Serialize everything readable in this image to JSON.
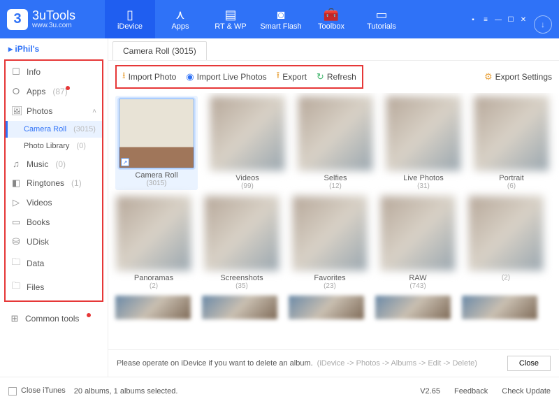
{
  "brand": {
    "name": "3uTools",
    "site": "www.3u.com",
    "logo_char": "3"
  },
  "topnav": [
    {
      "label": "iDevice"
    },
    {
      "label": "Apps"
    },
    {
      "label": "RT & WP"
    },
    {
      "label": "Smart Flash"
    },
    {
      "label": "Toolbox"
    },
    {
      "label": "Tutorials"
    }
  ],
  "sidebar": {
    "device": "iPhil's",
    "items": [
      {
        "icon": "☐",
        "label": "Info"
      },
      {
        "icon": "⭘",
        "label": "Apps",
        "count": "(87)",
        "dot": true
      },
      {
        "icon": "🖼",
        "label": "Photos",
        "expand": "˄"
      },
      {
        "sub": true,
        "selected": true,
        "label": "Camera Roll",
        "count": "(3015)"
      },
      {
        "sub": true,
        "label": "Photo Library",
        "count": "(0)"
      },
      {
        "icon": "♫",
        "label": "Music",
        "count": "(0)"
      },
      {
        "icon": "◧",
        "label": "Ringtones",
        "count": "(1)"
      },
      {
        "icon": "▷",
        "label": "Videos"
      },
      {
        "icon": "▭",
        "label": "Books"
      },
      {
        "icon": "⛁",
        "label": "UDisk"
      },
      {
        "icon": "🗀",
        "label": "Data"
      },
      {
        "icon": "🗀",
        "label": "Files"
      }
    ],
    "common": {
      "icon": "⊞",
      "label": "Common tools",
      "dot": true
    }
  },
  "tab": {
    "label": "Camera Roll (3015)"
  },
  "toolbar": {
    "import": "Import Photo",
    "import_live": "Import Live Photos",
    "export": "Export",
    "refresh": "Refresh",
    "export_settings": "Export Settings"
  },
  "albums_row1": [
    {
      "label": "Camera Roll",
      "count": "(3015)",
      "selected": true
    },
    {
      "label": "Videos",
      "count": "(99)"
    },
    {
      "label": "Selfies",
      "count": "(12)"
    },
    {
      "label": "Live Photos",
      "count": "(31)"
    },
    {
      "label": "Portrait",
      "count": "(6)"
    }
  ],
  "albums_row2": [
    {
      "label": "Panoramas",
      "count": "(2)"
    },
    {
      "label": "Screenshots",
      "count": "(35)"
    },
    {
      "label": "Favorites",
      "count": "(23)"
    },
    {
      "label": "RAW",
      "count": "(743)"
    },
    {
      "label": "",
      "count": "(2)"
    }
  ],
  "info_bar": {
    "msg": "Please operate on iDevice if you want to delete an album.",
    "hint": "(iDevice -> Photos -> Albums -> Edit -> Delete)",
    "close": "Close"
  },
  "footer": {
    "close_itunes": "Close iTunes",
    "status": "20 albums, 1 albums selected.",
    "version": "V2.65",
    "feedback": "Feedback",
    "update": "Check Update"
  }
}
